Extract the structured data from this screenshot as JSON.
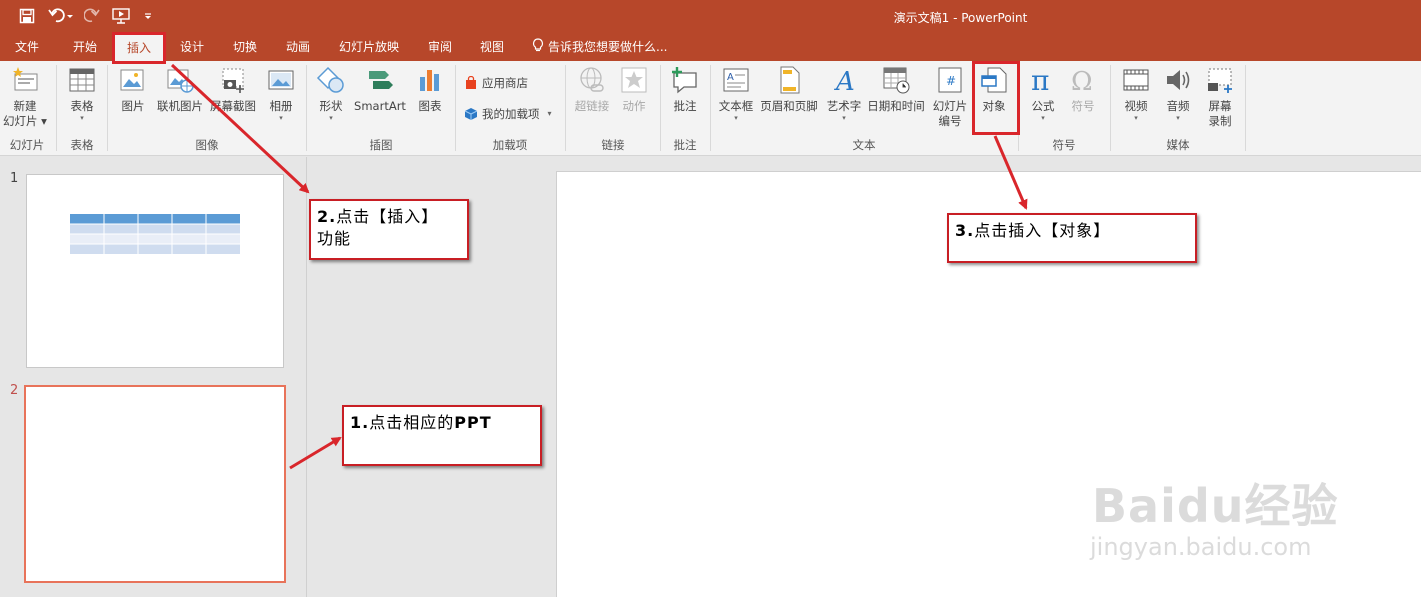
{
  "window": {
    "title": "演示文稿1 - PowerPoint"
  },
  "quick_access": {
    "save": "save-icon",
    "undo": "undo-icon",
    "redo": "redo-icon",
    "present": "start-from-beginning-icon",
    "customize": "customize-qat-icon"
  },
  "tabs": [
    "文件",
    "开始",
    "插入",
    "设计",
    "切换",
    "动画",
    "幻灯片放映",
    "审阅",
    "视图"
  ],
  "active_tab": "插入",
  "tell_me": "告诉我您想要做什么...",
  "ribbon": {
    "groups": {
      "slides": "幻灯片",
      "tables": "表格",
      "images": "图像",
      "illustrations": "插图",
      "addins": "加载项",
      "links": "链接",
      "comments": "批注",
      "text": "文本",
      "symbols": "符号",
      "media": "媒体"
    },
    "buttons": {
      "new_slide_1": "新建",
      "new_slide_2": "幻灯片",
      "table": "表格",
      "picture": "图片",
      "online_picture": "联机图片",
      "screenshot": "屏幕截图",
      "album": "相册",
      "shapes": "形状",
      "smartart": "SmartArt",
      "chart": "图表",
      "store": "应用商店",
      "my_addins": "我的加载项",
      "hyperlink": "超链接",
      "action": "动作",
      "comment": "批注",
      "textbox": "文本框",
      "header_footer": "页眉和页脚",
      "wordart": "艺术字",
      "datetime": "日期和时间",
      "slide_number_1": "幻灯片",
      "slide_number_2": "编号",
      "object": "对象",
      "equation": "公式",
      "symbol": "符号",
      "video": "视频",
      "audio": "音频",
      "screen_record_1": "屏幕",
      "screen_record_2": "录制"
    }
  },
  "slides": [
    {
      "number": "1"
    },
    {
      "number": "2"
    }
  ],
  "annotations": {
    "step1_num": "1.",
    "step1_text": "点击相应的",
    "step1_bold": "PPT",
    "step2_num": "2.",
    "step2_text_a": "点击【插入】",
    "step2_text_b": "功能",
    "step3_num": "3.",
    "step3_text": "点击插入【对象】",
    "highlight_color": "#d9262b"
  },
  "watermark": {
    "brand": "Baidu经验",
    "url": "jingyan.baidu.com"
  }
}
